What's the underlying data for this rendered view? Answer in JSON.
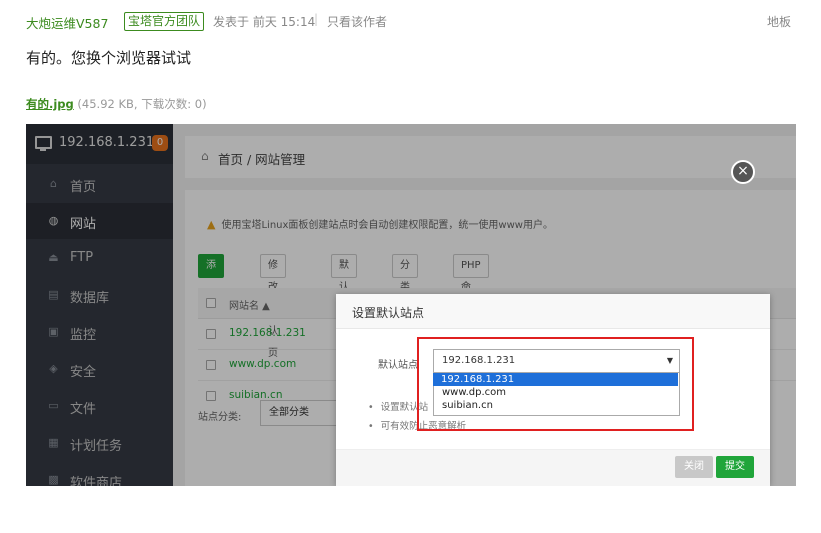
{
  "post": {
    "author": "大炮运维V587",
    "badge": "宝塔官方团队",
    "time": "发表于 前天 15:14",
    "separator": "|",
    "only_author": "只看该作者",
    "floor": "地板",
    "content": "有的。您换个浏览器试试",
    "attachment": {
      "name": "有的.jpg",
      "meta": " (45.92 KB, 下载次数: 0)"
    }
  },
  "screenshot": {
    "host": "192.168.1.231",
    "host_badge": "0",
    "nav": [
      {
        "label": "首页",
        "icon": "home-icon"
      },
      {
        "label": "网站",
        "icon": "globe-icon"
      },
      {
        "label": "FTP",
        "icon": "ftp-icon"
      },
      {
        "label": "数据库",
        "icon": "database-icon"
      },
      {
        "label": "监控",
        "icon": "monitor-icon"
      },
      {
        "label": "安全",
        "icon": "shield-icon"
      },
      {
        "label": "文件",
        "icon": "folder-icon"
      },
      {
        "label": "计划任务",
        "icon": "calendar-icon"
      },
      {
        "label": "软件商店",
        "icon": "grid-icon"
      }
    ],
    "active_nav": "网站",
    "breadcrumb": "首页 / 网站管理",
    "warning": "使用宝塔Linux面板创建站点时会自动创建权限配置，统一使用www用户。",
    "buttons": [
      "添加站点",
      "修改默认页",
      "默认站点",
      "分类管理",
      "PHP命令行版本"
    ],
    "table_header": "网站名 ▲",
    "rows": [
      "192.168.1.231",
      "www.dp.com",
      "suibian.cn"
    ],
    "category_label": "站点分类:",
    "category_value": "全部分类",
    "modal": {
      "title": "设置默认站点",
      "field_label": "默认站点",
      "selected": "192.168.1.231",
      "options": [
        "192.168.1.231",
        "www.dp.com",
        "suibian.cn"
      ],
      "tips": [
        "设置默认站",
        "可有效防止恶意解析"
      ],
      "close_label": "关闭",
      "submit_label": "提交"
    }
  },
  "colors": {
    "accent_green": "#20a53a",
    "author_green": "#3c8b1f",
    "highlight_red": "#e02020",
    "sidebar_bg": "#353a44"
  }
}
